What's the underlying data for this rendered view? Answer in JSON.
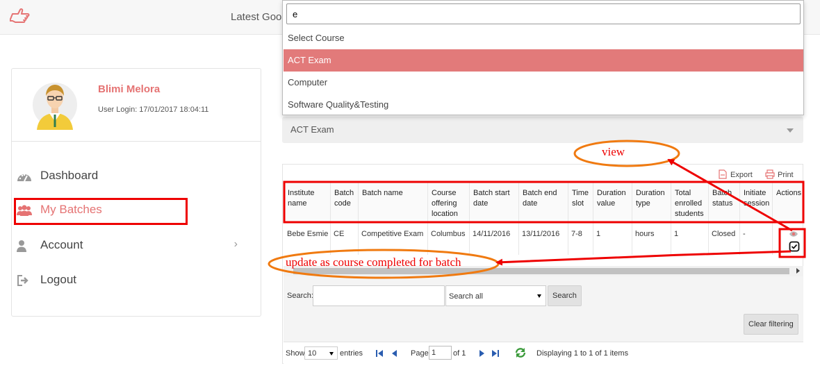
{
  "topbar": {
    "news_text": "Latest Goog",
    "hand_icon": "pointing-hand-icon"
  },
  "profile": {
    "name": "Blimi Melora",
    "login": "User Login: 17/01/2017 18:04:11"
  },
  "nav": [
    {
      "label": "Dashboard",
      "icon": "dashboard-icon"
    },
    {
      "label": "My Batches",
      "icon": "users-icon",
      "active": true
    },
    {
      "label": "Account",
      "icon": "user-icon"
    },
    {
      "label": "Logout",
      "icon": "logout-icon"
    }
  ],
  "course_select": {
    "value": "ACT Exam",
    "search_text": "e",
    "options": [
      "Select Course",
      "ACT Exam",
      "Computer",
      "Software Quality&Testing"
    ],
    "highlighted": "ACT Exam",
    "highlight_color": "#e27a7a"
  },
  "toolbar": {
    "export_label": "Export",
    "print_label": "Print"
  },
  "table": {
    "headers": [
      [
        "Institute",
        "name"
      ],
      [
        "Batch",
        "code"
      ],
      [
        "Batch name"
      ],
      [
        "Course",
        "offering",
        "location"
      ],
      [
        "Batch start",
        "date"
      ],
      [
        "Batch end",
        "date"
      ],
      [
        "Time",
        "slot"
      ],
      [
        "Duration",
        "value"
      ],
      [
        "Duration",
        "type"
      ],
      [
        "Total",
        "enrolled",
        "students"
      ],
      [
        "Batch",
        "status"
      ],
      [
        "Initiate",
        "session"
      ],
      [
        "Actions"
      ]
    ],
    "rows": [
      [
        "Bebe Esmie",
        "CE",
        "Competitive Exam",
        "Columbus",
        "14/11/2016",
        "13/11/2016",
        "7-8",
        "1",
        "hours",
        "1",
        "Closed",
        "-"
      ]
    ]
  },
  "filter": {
    "search_label": "Search:",
    "search_value": "",
    "scope": "Search all",
    "search_button": "Search",
    "clear_button": "Clear filtering"
  },
  "pager": {
    "show": "Show",
    "entries_value": "10",
    "entries": "entries",
    "page_label": "Page",
    "page_value": "1",
    "of_label": "of 1",
    "display": "Displaying 1 to 1 of 1 items"
  },
  "annotations": {
    "view_label": "view",
    "update_label": "update as course completed for batch",
    "color": "#e00000"
  }
}
